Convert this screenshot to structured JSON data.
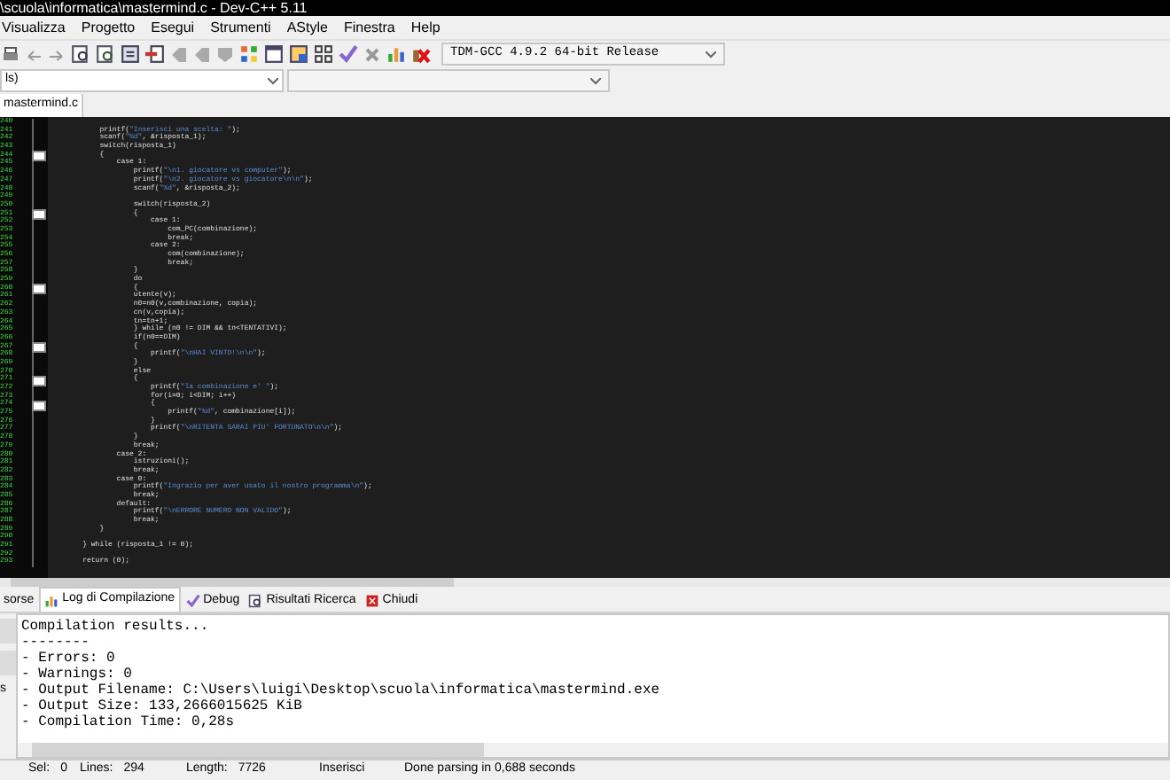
{
  "window": {
    "title": "\\scuola\\informatica\\mastermind.c - Dev-C++ 5.11"
  },
  "menu": [
    "Visualizza",
    "Progetto",
    "Esegui",
    "Strumenti",
    "AStyle",
    "Finestra",
    "Help"
  ],
  "compiler_select": {
    "value": "TDM-GCC 4.9.2 64-bit Release"
  },
  "scope_select": {
    "value": "ls)"
  },
  "editor_tabs": [
    {
      "label": "mastermind.c",
      "selected": true
    }
  ],
  "code_lines": [
    {
      "number": "240",
      "fold": false
    },
    {
      "number": "241",
      "fold": false,
      "code": "        printf(\"Inserisci una scelta: \");"
    },
    {
      "number": "242",
      "fold": false,
      "code": "        scanf(\"%d\", &risposta_1);"
    },
    {
      "number": "243",
      "fold": false,
      "code": "        switch(risposta_1)"
    },
    {
      "number": "244",
      "fold": true,
      "code": "        {"
    },
    {
      "number": "245",
      "fold": false,
      "code": "            case 1:"
    },
    {
      "number": "246",
      "fold": false,
      "code": "                printf(\"\\n1. giocatore vs computer\");"
    },
    {
      "number": "247",
      "fold": false,
      "code": "                printf(\"\\n2. giocatore vs giocatore\\n\\n\");"
    },
    {
      "number": "248",
      "fold": false,
      "code": "                scanf(\"%d\", &risposta_2);"
    },
    {
      "number": "249",
      "fold": false
    },
    {
      "number": "250",
      "fold": false,
      "code": "                switch(risposta_2)"
    },
    {
      "number": "251",
      "fold": true,
      "code": "                {"
    },
    {
      "number": "252",
      "fold": false,
      "code": "                    case 1:"
    },
    {
      "number": "253",
      "fold": false,
      "code": "                        com_PC(combinazione);"
    },
    {
      "number": "254",
      "fold": false,
      "code": "                        break;"
    },
    {
      "number": "255",
      "fold": false,
      "code": "                    case 2:"
    },
    {
      "number": "256",
      "fold": false,
      "code": "                        com(combinazione);"
    },
    {
      "number": "257",
      "fold": false,
      "code": "                        break;"
    },
    {
      "number": "258",
      "fold": false,
      "code": "                }"
    },
    {
      "number": "259",
      "fold": false,
      "code": "                do"
    },
    {
      "number": "260",
      "fold": true,
      "code": "                {"
    },
    {
      "number": "261",
      "fold": false,
      "code": "                utente(v);"
    },
    {
      "number": "262",
      "fold": false,
      "code": "                n0=n0(v,combinazione, copia);"
    },
    {
      "number": "263",
      "fold": false,
      "code": "                cn(v,copia);"
    },
    {
      "number": "264",
      "fold": false,
      "code": "                tn=tn+1;"
    },
    {
      "number": "265",
      "fold": false,
      "code": "                } while (n0 != DIM && tn<TENTATIVI);"
    },
    {
      "number": "266",
      "fold": false,
      "code": "                if(n0==DIM)"
    },
    {
      "number": "267",
      "fold": true,
      "code": "                {"
    },
    {
      "number": "268",
      "fold": false,
      "code": "                    printf(\"\\nHAI VINTO!\\n\\n\");"
    },
    {
      "number": "269",
      "fold": false,
      "code": "                }"
    },
    {
      "number": "270",
      "fold": false,
      "code": "                else"
    },
    {
      "number": "271",
      "fold": true,
      "code": "                {"
    },
    {
      "number": "272",
      "fold": false,
      "code": "                    printf(\"la combinazione e' \");"
    },
    {
      "number": "273",
      "fold": false,
      "code": "                    for(i=0; i<DIM; i++)"
    },
    {
      "number": "274",
      "fold": true,
      "code": "                    {"
    },
    {
      "number": "275",
      "fold": false,
      "code": "                        printf(\"%d\", combinazione[i]);"
    },
    {
      "number": "276",
      "fold": false,
      "code": "                    }"
    },
    {
      "number": "277",
      "fold": false,
      "code": "                    printf(\"\\nRITENTA SARAI PIU' FORTUNATO\\n\\n\");"
    },
    {
      "number": "278",
      "fold": false,
      "code": "                }"
    },
    {
      "number": "279",
      "fold": false,
      "code": "                break;"
    },
    {
      "number": "280",
      "fold": false,
      "code": "            case 2:"
    },
    {
      "number": "281",
      "fold": false,
      "code": "                istruzioni();"
    },
    {
      "number": "282",
      "fold": false,
      "code": "                break;"
    },
    {
      "number": "283",
      "fold": false,
      "code": "            case 0:"
    },
    {
      "number": "284",
      "fold": false,
      "code": "                printf(\"Ingrazio per aver usato il nostro programma\\n\");"
    },
    {
      "number": "285",
      "fold": false,
      "code": "                break;"
    },
    {
      "number": "286",
      "fold": false,
      "code": "            default:"
    },
    {
      "number": "287",
      "fold": false,
      "code": "                printf(\"\\nERRORE NUMERO NON VALIDO\");"
    },
    {
      "number": "288",
      "fold": false,
      "code": "                break;"
    },
    {
      "number": "289",
      "fold": false,
      "code": "        }"
    },
    {
      "number": "290",
      "fold": false
    },
    {
      "number": "291",
      "fold": false,
      "code": "    } while (risposta_1 != 0);"
    },
    {
      "number": "292",
      "fold": false
    },
    {
      "number": "293",
      "fold": false,
      "code": "    return (0);"
    }
  ],
  "bottom_tabs": [
    {
      "label": "sorse",
      "selected": false,
      "kind": "none"
    },
    {
      "label": "Log di Compilazione",
      "selected": true,
      "kind": "chart"
    },
    {
      "label": "Debug",
      "selected": false,
      "kind": "check"
    },
    {
      "label": "Risultati Ricerca",
      "selected": false,
      "kind": "search"
    },
    {
      "label": "Chiudi",
      "selected": false,
      "kind": "close"
    }
  ],
  "side_panel_text": "s",
  "log": [
    "Compilation results...",
    "--------",
    "- Errors: 0",
    "- Warnings: 0",
    "- Output Filename: C:\\Users\\luigi\\Desktop\\scuola\\informatica\\mastermind.exe",
    "- Output Size: 133,2666015625 KiB",
    "- Compilation Time: 0,28s"
  ],
  "status_bar": [
    {
      "label": "Sel:",
      "value": "0"
    },
    {
      "label": "Lines:",
      "value": "294"
    },
    {
      "label": "Length:",
      "value": "7726"
    },
    {
      "value": "Inserisci"
    },
    {
      "value": "Done parsing in 0,688 seconds"
    }
  ]
}
